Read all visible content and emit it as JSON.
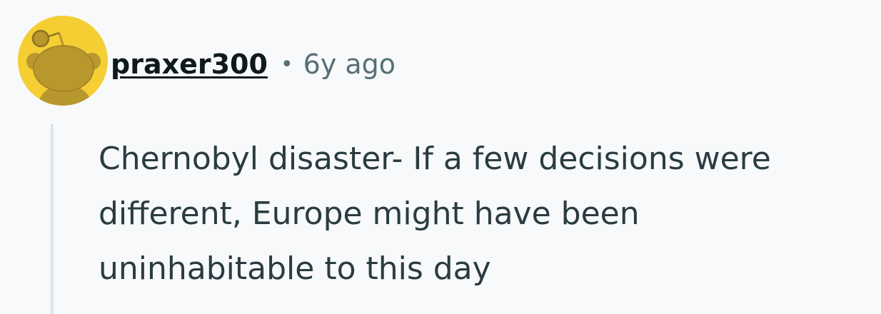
{
  "comment": {
    "author": "praxer300",
    "separator": "•",
    "timestamp": "6y ago",
    "body": "Chernobyl disaster- If a few decisions were different, Europe might have been uninhabitable to this day",
    "avatar_icon": "snoo-avatar-icon"
  },
  "colors": {
    "background": "#f7f9fa",
    "avatar_bg": "#f4ce33",
    "avatar_figure": "#b8972c",
    "username": "#0f1a1c",
    "meta": "#576f76",
    "body_text": "#2a3c42",
    "thread_line": "#dbe4e9"
  }
}
